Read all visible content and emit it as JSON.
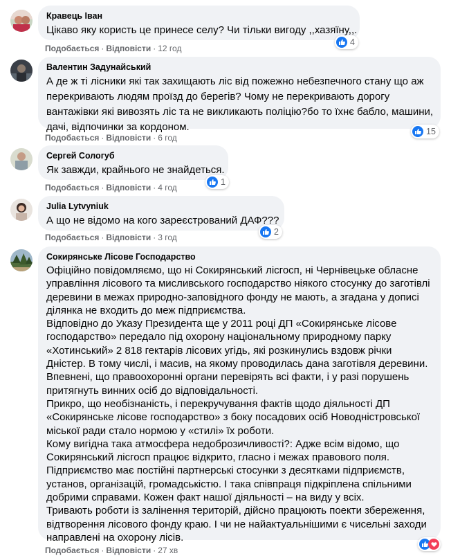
{
  "actions": {
    "like": "Подобається",
    "reply": "Відповісти",
    "separator": "·"
  },
  "colors": {
    "bubble": "#f0f2f5",
    "like": "#1877f2",
    "meta": "#65676b"
  },
  "comments": [
    {
      "author": "Кравець Іван",
      "lines": [
        "Цікаво яку користь це принесе селу? Чи тільки вигоду ,,хазяїну,,."
      ],
      "time": "12 год",
      "reactions": "4"
    },
    {
      "author": "Валентин Задунайський",
      "lines": [
        "А де ж ті лісники які так захищають ліс від пожежно небезпечного стану що аж",
        "перекривають людям проїзд до берегів? Чому не перекривають дорогу",
        "вантажівки які вивозять ліс та не викликають поліцію?бо то їхнє бабло, машини,",
        "дачі, відпочинки за кордоном."
      ],
      "time": "6 год",
      "reactions": "15"
    },
    {
      "author": "Сергей Сологуб",
      "lines": [
        "Як завжди, крайнього не знайдеться."
      ],
      "time": "4 год",
      "reactions": "1"
    },
    {
      "author": "Julia Lytvyniuk",
      "lines": [
        "А що не відомо на кого зареєстрований ДАФ???"
      ],
      "time": "3 год",
      "reactions": "2"
    },
    {
      "author": "Сокирянське Лісове Господарство",
      "lines": [
        "Офіційно повідомляємо, що ні Сокирянський лісгосп, ні Чернівецьке обласне",
        "управління лісового та мисливського господарство ніякого стосунку до заготівлі",
        "деревини в межах природно-заповідного фонду не мають, а згадана у дописі",
        "ділянка не входить до меж підприємства.",
        "Відповідно до Указу Президента ще у 2011 році ДП «Сокирянське лісове",
        "господарство» передало під охорону національному природному парку",
        "«Хотинський» 2 818 гектарів лісових угідь, які розкинулись вздовж річки",
        "Дністер. В тому числі, і масив, на якому проводилась дана заготівля деревини.",
        "Впевнені, що правоохоронні органи перевірять всі факти, і у разі порушень",
        "притягнуть винних осіб до відповідальності.",
        "Прикро, що необізнаність, і перекручування фактів щодо діяльності ДП",
        "«Сокирянське лісове господарство» з боку посадових осіб Новодністровської",
        "міської ради стало нормою у «стилі» їх роботи.",
        "Кому вигідна така атмосфера недоброзичливості?: Адже всім відомо, що",
        "Сокирянський лісгосп працює відкрито, гласно і межах правового поля.",
        "Підприємство має постійні партнерські стосунки з десятками підприємств,",
        "установ, організацій, громадськістю. І така співпраця підкріплена спільними",
        "добрими справами. Кожен факт нашої діяльності – на виду у всіх.",
        "Тривають роботи із залінення територій, дійсно працюють поекти збереження,",
        "відтворення лісового фонду краю. І чи не найактуальнішими є чисельні заходи",
        "направлені на охорону лісів."
      ],
      "time": "27 хв",
      "reactions": ""
    }
  ]
}
